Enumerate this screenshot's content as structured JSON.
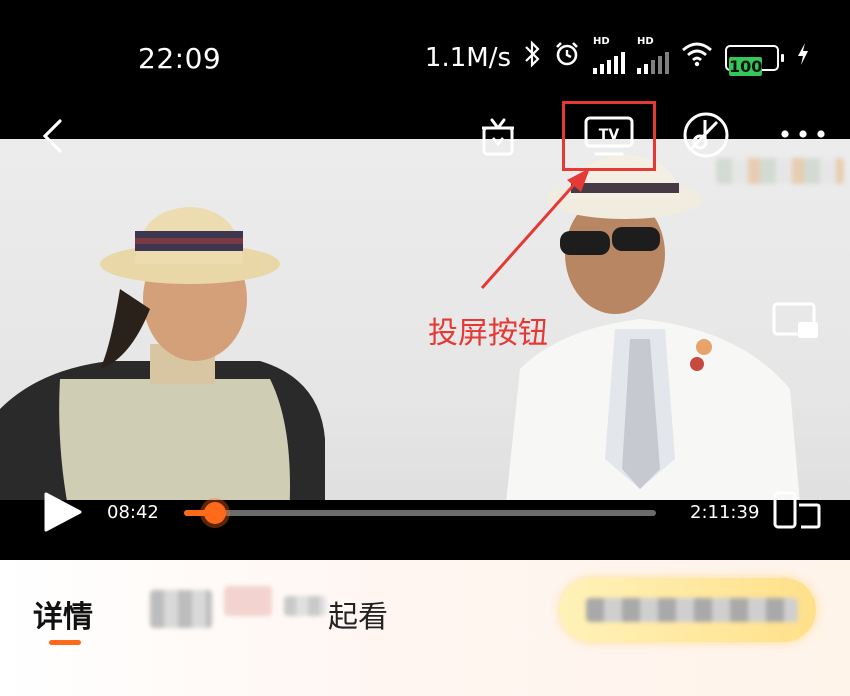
{
  "status_bar": {
    "time": "22:09",
    "network_speed": "1.1M/s",
    "signal1_label": "HD",
    "signal2_label": "HD",
    "battery_level": "100"
  },
  "player": {
    "current_time": "08:42",
    "total_time": "2:11:39",
    "progress_fraction": 0.066,
    "accent_color": "#ff6a1a"
  },
  "annotation": {
    "label": "投屏按钮",
    "color": "#e53935"
  },
  "toolbar": {
    "tv_icon_label": "TV"
  },
  "tabs": {
    "details_label": "详情",
    "together_label": "起看"
  }
}
